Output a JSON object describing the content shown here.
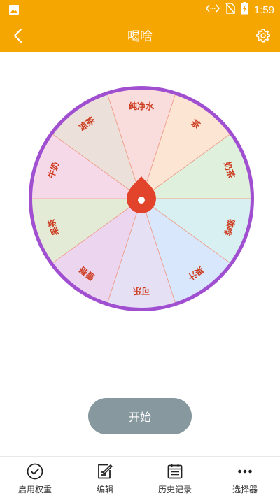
{
  "status_bar": {
    "time": "1:59",
    "icons": [
      "image-icon",
      "code-icon",
      "no-sim-icon",
      "battery-charging-icon"
    ]
  },
  "app_bar": {
    "title": "喝啥",
    "back_icon": "chevron-left-icon",
    "settings_icon": "gear-icon"
  },
  "wheel": {
    "segments": [
      {
        "label": "纯净水",
        "color": "#f9dcdc"
      },
      {
        "label": "茶",
        "color": "#fde5d4"
      },
      {
        "label": "奶茶",
        "color": "#dff0dc"
      },
      {
        "label": "咖啡",
        "color": "#d9f0f2"
      },
      {
        "label": "果汁",
        "color": "#d8e7fb"
      },
      {
        "label": "可乐",
        "color": "#e6e0f4"
      },
      {
        "label": "雪碧",
        "color": "#ecd6ef"
      },
      {
        "label": "果茶",
        "color": "#e3ead6"
      },
      {
        "label": "牛奶",
        "color": "#f6d9e9"
      },
      {
        "label": "凉茶",
        "color": "#ece0da"
      }
    ],
    "rim_color": "#a04fd1",
    "divider_color": "#ef9a87",
    "label_color": "#cc3b1f",
    "pointer_color": "#e2432b"
  },
  "start_button": {
    "label": "开始"
  },
  "bottom_nav": [
    {
      "label": "启用权重",
      "icon": "check-circle-icon"
    },
    {
      "label": "编辑",
      "icon": "edit-icon"
    },
    {
      "label": "历史记录",
      "icon": "history-icon"
    },
    {
      "label": "选择器",
      "icon": "more-icon"
    }
  ]
}
